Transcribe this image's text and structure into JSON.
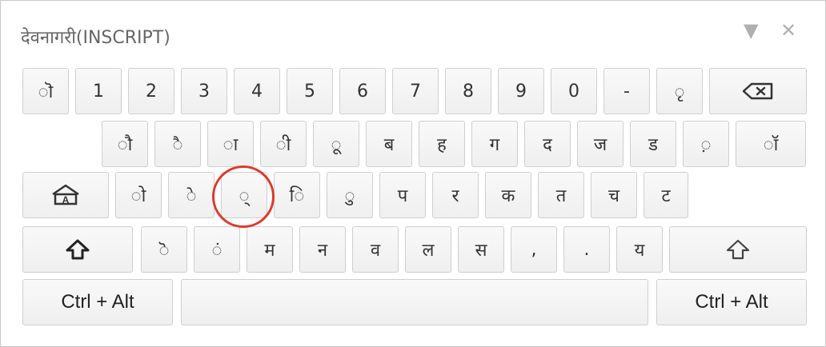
{
  "window": {
    "title": "देवनागरी(INSCRIPT)",
    "minimize_icon": "triangle-down-icon",
    "close_icon": "close-icon"
  },
  "rows": [
    [
      "ॊ",
      "1",
      "2",
      "3",
      "4",
      "5",
      "6",
      "7",
      "8",
      "9",
      "0",
      "-",
      "ृ"
    ],
    [
      "ौ",
      "ै",
      "ा",
      "ी",
      "ू",
      "ब",
      "ह",
      "ग",
      "द",
      "ज",
      "ड",
      "़",
      "ॉ"
    ],
    [
      "ो",
      "े",
      "्",
      "ि",
      "ु",
      "प",
      "र",
      "क",
      "त",
      "च",
      "ट"
    ],
    [
      "ॆ",
      "ं",
      "म",
      "न",
      "व",
      "ल",
      "स",
      ",",
      ".",
      "य"
    ]
  ],
  "special_keys": {
    "backspace_icon": "backspace-icon",
    "caps_icon": "home-caps-icon",
    "shift_icon": "shift-icon",
    "ctrl_alt_label": "Ctrl + Alt"
  },
  "highlighted_key": "्"
}
